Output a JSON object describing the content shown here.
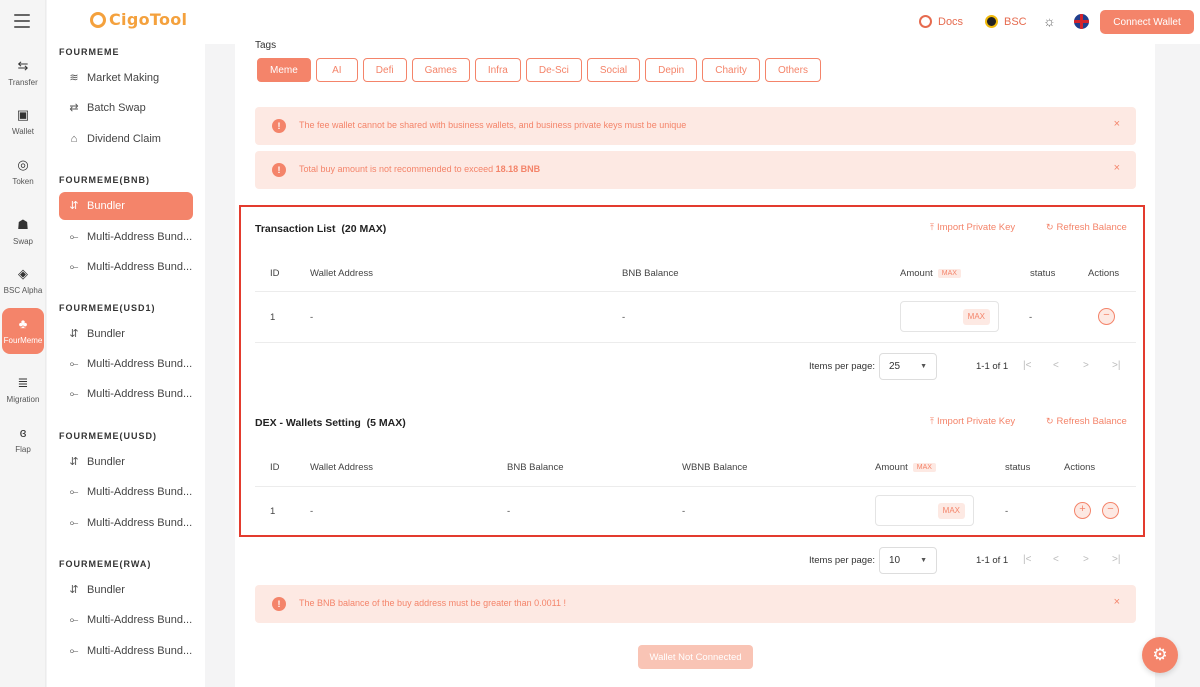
{
  "rail": {
    "items": [
      {
        "label": "Transfer",
        "icon": "transfer-icon",
        "glyph": "⇆"
      },
      {
        "label": "Wallet",
        "icon": "wallet-icon",
        "glyph": "▣"
      },
      {
        "label": "Token",
        "icon": "token-icon",
        "glyph": "◎"
      },
      {
        "label": "Swap",
        "icon": "swap-icon",
        "glyph": "☗"
      },
      {
        "label": "BSC Alpha",
        "icon": "bsc-alpha-icon",
        "glyph": "◈"
      },
      {
        "label": "FourMeme",
        "icon": "fourmeme-icon",
        "glyph": "♣"
      },
      {
        "label": "Migration",
        "icon": "migration-icon",
        "glyph": "≣"
      },
      {
        "label": "Flap",
        "icon": "butterfly-icon",
        "glyph": "ɞ"
      }
    ]
  },
  "brand": {
    "name": "CigoTool",
    "accent": "#f4846a",
    "logo_color": "#f4a13d"
  },
  "sidebar": {
    "sections": [
      {
        "title": "FOURMEME",
        "items": [
          "Market Making",
          "Batch Swap",
          "Dividend Claim"
        ]
      },
      {
        "title": "FOURMEME(BNB)",
        "items": [
          "Bundler",
          "Multi-Address Bund...",
          "Multi-Address Bund..."
        ]
      },
      {
        "title": "FOURMEME(USD1)",
        "items": [
          "Bundler",
          "Multi-Address Bund...",
          "Multi-Address Bund..."
        ]
      },
      {
        "title": "FOURMEME(UUSD)",
        "items": [
          "Bundler",
          "Multi-Address Bund...",
          "Multi-Address Bund..."
        ]
      },
      {
        "title": "FOURMEME(RWA)",
        "items": [
          "Bundler",
          "Multi-Address Bund...",
          "Multi-Address Bund..."
        ]
      }
    ]
  },
  "topbar": {
    "docs": "Docs",
    "network": "BSC",
    "connect": "Connect Wallet"
  },
  "tags": {
    "label": "Tags",
    "items": [
      "Meme",
      "AI",
      "Defi",
      "Games",
      "Infra",
      "De-Sci",
      "Social",
      "Depin",
      "Charity",
      "Others"
    ],
    "selected": "Meme"
  },
  "alerts": {
    "fee": "The fee wallet cannot be shared with business wallets, and business private keys must be unique",
    "buy_prefix": "Total buy amount is not recommended to exceed ",
    "buy_value": "18.18 BNB",
    "balance": "The BNB balance of the buy address must be greater than 0.0011 !"
  },
  "transaction_list": {
    "title": "Transaction List",
    "max": "(20 MAX)",
    "import": "Import Private Key",
    "refresh": "Refresh Balance",
    "columns": {
      "id": "ID",
      "wallet": "Wallet Address",
      "balance": "BNB Balance",
      "amount": "Amount",
      "max": "MAX",
      "status": "status",
      "actions": "Actions"
    },
    "rows": [
      {
        "id": "1",
        "wallet": "-",
        "balance": "-",
        "status": "-",
        "max": "MAX"
      }
    ],
    "pager": {
      "label": "Items per page:",
      "per_page": "25",
      "range": "1-1 of 1"
    }
  },
  "dex_wallets": {
    "title": "DEX - Wallets Setting",
    "max": "(5 MAX)",
    "import": "Import Private Key",
    "refresh": "Refresh Balance",
    "columns": {
      "id": "ID",
      "wallet": "Wallet Address",
      "bnb": "BNB Balance",
      "wbnb": "WBNB Balance",
      "amount": "Amount",
      "max": "MAX",
      "status": "status",
      "actions": "Actions"
    },
    "rows": [
      {
        "id": "1",
        "wallet": "-",
        "bnb": "-",
        "wbnb": "-",
        "status": "-",
        "max": "MAX"
      }
    ],
    "pager": {
      "label": "Items per page:",
      "per_page": "10",
      "range": "1-1 of 1"
    }
  },
  "footer_button": "Wallet Not Connected"
}
